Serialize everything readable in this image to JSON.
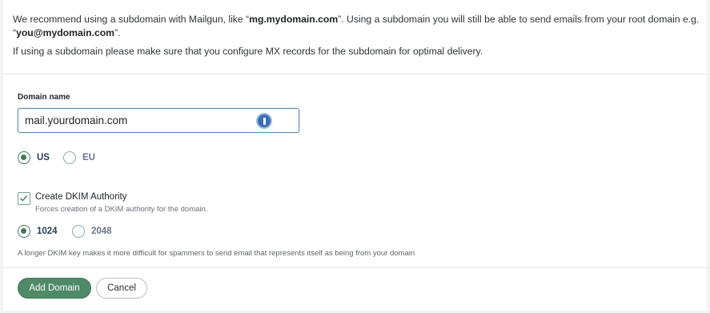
{
  "notice": {
    "line1_pre": "We recommend using a subdomain with Mailgun, like “",
    "line1_example": "mg.mydomain.com",
    "line1_mid": "”. Using a subdomain you will still be able to send emails from your root domain e.g. “",
    "line1_example2": "you@mydomain.com",
    "line1_post": "”.",
    "line2": "If using a subdomain please make sure that you configure MX records for the subdomain for optimal delivery."
  },
  "form": {
    "domain_label": "Domain name",
    "domain_value": "mail.yourdomain.com",
    "region_options": [
      {
        "label": "US",
        "selected": true
      },
      {
        "label": "EU",
        "selected": false
      }
    ],
    "dkim_checkbox_label": "Create DKIM Authority",
    "dkim_checkbox_checked": true,
    "dkim_help": "Forces creation of a DKIM authority for the domain.",
    "key_options": [
      {
        "label": "1024",
        "selected": true
      },
      {
        "label": "2048",
        "selected": false
      }
    ],
    "dkim_note": "A longer DKIM key makes it more difficult for spammers to send email that represents itself as being from your domain"
  },
  "footer": {
    "add_label": "Add Domain",
    "cancel_label": "Cancel"
  },
  "colors": {
    "accent": "#4f8a68",
    "radio_selected": "#3f7a5a",
    "input_border": "#5b8fb0"
  },
  "icons": {
    "password_manager": "password-manager-icon",
    "checkbox_check": "check-icon"
  }
}
